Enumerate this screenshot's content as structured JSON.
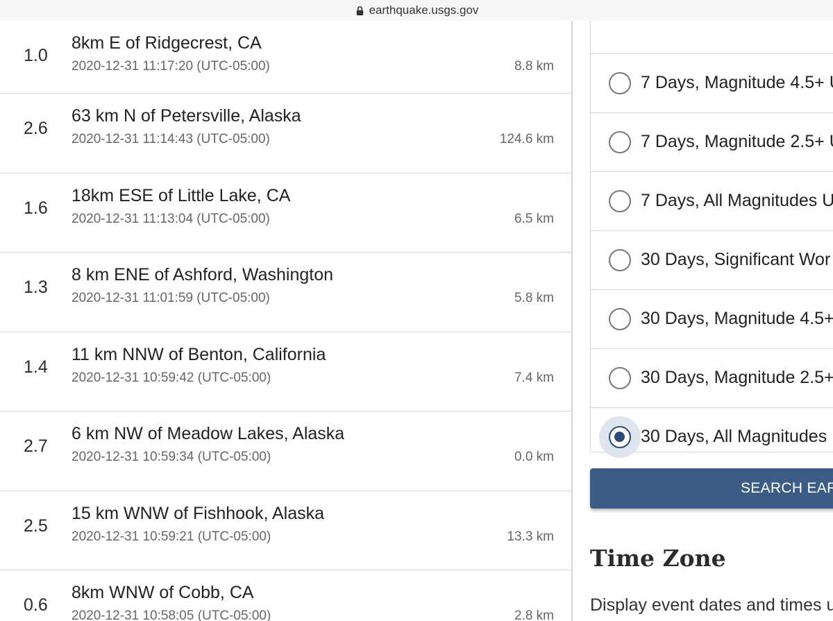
{
  "browser": {
    "url": "earthquake.usgs.gov",
    "lock_icon": "lock-icon"
  },
  "earthquakes": [
    {
      "magnitude": "1.0",
      "place": "8km E of Ridgecrest, CA",
      "time": "2020-12-31 11:17:20 (UTC-05:00)",
      "depth": "8.8 km"
    },
    {
      "magnitude": "2.6",
      "place": "63 km N of Petersville, Alaska",
      "time": "2020-12-31 11:14:43 (UTC-05:00)",
      "depth": "124.6 km"
    },
    {
      "magnitude": "1.6",
      "place": "18km ESE of Little Lake, CA",
      "time": "2020-12-31 11:13:04 (UTC-05:00)",
      "depth": "6.5 km"
    },
    {
      "magnitude": "1.3",
      "place": "8 km ENE of Ashford, Washington",
      "time": "2020-12-31 11:01:59 (UTC-05:00)",
      "depth": "5.8 km"
    },
    {
      "magnitude": "1.4",
      "place": "11 km NNW of Benton, California",
      "time": "2020-12-31 10:59:42 (UTC-05:00)",
      "depth": "7.4 km"
    },
    {
      "magnitude": "2.7",
      "place": "6 km NW of Meadow Lakes, Alaska",
      "time": "2020-12-31 10:59:34 (UTC-05:00)",
      "depth": "0.0 km"
    },
    {
      "magnitude": "2.5",
      "place": "15 km WNW of Fishhook, Alaska",
      "time": "2020-12-31 10:59:21 (UTC-05:00)",
      "depth": "13.3 km"
    },
    {
      "magnitude": "0.6",
      "place": "8km WNW of Cobb, CA",
      "time": "2020-12-31 10:58:05 (UTC-05:00)",
      "depth": "2.8 km"
    }
  ],
  "feed_options": [
    {
      "label": "7 Days, Magnitude 4.5+ U",
      "checked": false
    },
    {
      "label": "7 Days, Magnitude 2.5+ U",
      "checked": false
    },
    {
      "label": "7 Days, All Magnitudes U",
      "checked": false
    },
    {
      "label": "30 Days, Significant Wor",
      "checked": false
    },
    {
      "label": "30 Days, Magnitude 4.5+",
      "checked": false
    },
    {
      "label": "30 Days, Magnitude 2.5+",
      "checked": false
    },
    {
      "label": "30 Days, All Magnitudes",
      "checked": true
    }
  ],
  "search_button": "SEARCH EAR",
  "time_zone": {
    "title": "Time Zone",
    "description": "Display event dates and times u"
  },
  "colors": {
    "button": "#3b5d85",
    "radio_checked": "#2c4a73"
  }
}
